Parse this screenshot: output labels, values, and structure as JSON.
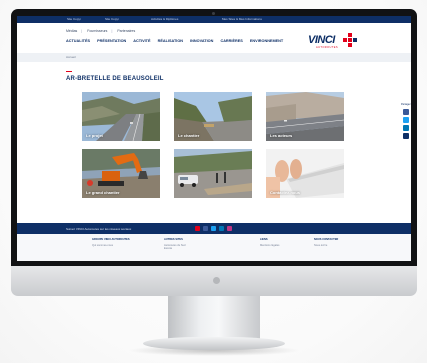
{
  "colors": {
    "navy": "#0e2f66",
    "red": "#e2001a",
    "bezel": "#111214",
    "footer_bg": "#f7f8fa"
  },
  "topbar": {
    "items": [
      "Site Copyi",
      "Site Copyi",
      "Activités & Diplômes",
      "Mes Sites & Mes Informations"
    ]
  },
  "header": {
    "util_links": [
      "Médias",
      "Fournisseurs",
      "Partenaires"
    ],
    "nav": [
      "ACTUALITÉS",
      "PRÉSENTATION",
      "ACTIVITÉ",
      "RÉALISATION",
      "INNOVATION",
      "CARRIÈRES",
      "ENVIRONNEMENT"
    ],
    "logo": "VINCI",
    "logo_sub": "AUTOROUTES"
  },
  "breadcrumb": "Accueil",
  "page_title": "AR-BRETELLE DE BEAUSOLEIL",
  "tiles": [
    {
      "caption": "Le projet",
      "scene": "highway-cliff"
    },
    {
      "caption": "Le chantier",
      "scene": "road-cutting"
    },
    {
      "caption": "Les acteurs",
      "scene": "viaduct-wall"
    },
    {
      "caption": "Le grand chantier",
      "scene": "excavator"
    },
    {
      "caption": "",
      "scene": "roadworks"
    },
    {
      "caption": "Contactez-nous",
      "scene": "keyboard"
    }
  ],
  "side_social": {
    "label": "Partager",
    "icons": [
      "facebook-icon",
      "twitter-icon",
      "linkedin-icon",
      "email-icon"
    ]
  },
  "footer_band": {
    "text": "Suivez VINCI Autoroutes sur les réseaux sociaux",
    "icons": [
      "youtube-icon",
      "facebook-icon",
      "twitter-icon",
      "linkedin-icon",
      "instagram-icon"
    ]
  },
  "footer_columns": [
    {
      "heading": "GROUPE VINCI AUTOROUTES",
      "links": [
        "Qui sommes-nous"
      ]
    },
    {
      "heading": "AUTRES SITES",
      "links": [
        "Autoroutes du Sud",
        "Escota"
      ]
    },
    {
      "heading": "LIENS",
      "links": [
        "Mentions légales"
      ]
    },
    {
      "heading": "NOUS CONTACTER",
      "links": [
        "Nous écrire"
      ]
    }
  ]
}
